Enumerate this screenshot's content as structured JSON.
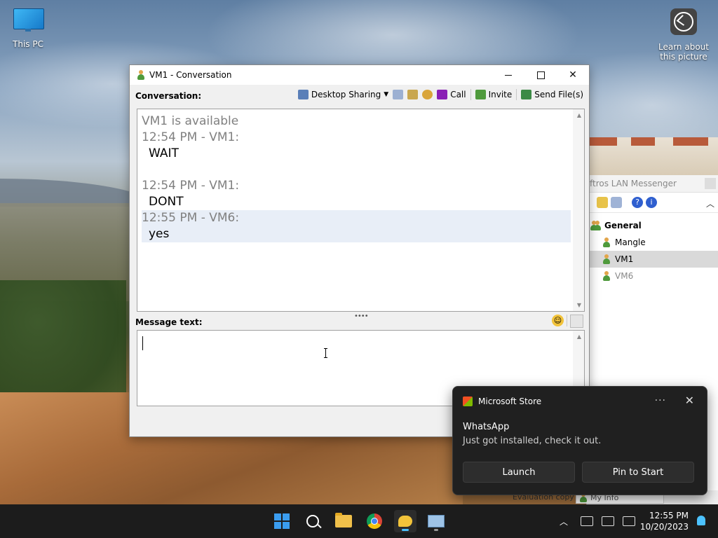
{
  "desktop": {
    "this_pc_label": "This PC",
    "learn_label_line1": "Learn about",
    "learn_label_line2": "this picture"
  },
  "buddy_list": {
    "title": "ftros LAN Messenger",
    "group_name": "General",
    "users": [
      {
        "name": "Mangle",
        "status": "online"
      },
      {
        "name": "VM1",
        "status": "online",
        "selected": true
      },
      {
        "name": "VM6",
        "status": "away"
      }
    ],
    "eval_text": "Evaluation copy",
    "my_info_label": "My Info"
  },
  "conversation": {
    "window_title": "VM1 - Conversation",
    "conversation_label": "Conversation:",
    "toolbar": {
      "desktop_sharing": "Desktop Sharing",
      "call": "Call",
      "invite": "Invite",
      "send_files": "Send File(s)"
    },
    "messages": [
      {
        "header": "VM1 is available",
        "text": ""
      },
      {
        "header": "12:54 PM - VM1:",
        "text": "WAIT"
      },
      {
        "header": "12:54 PM - VM1:",
        "text": "DONT"
      },
      {
        "header": "12:55 PM - VM6:",
        "text": "yes"
      }
    ],
    "message_text_label": "Message text:",
    "message_input_value": ""
  },
  "toast": {
    "source": "Microsoft Store",
    "app_name": "WhatsApp",
    "description": "Just got installed, check it out.",
    "launch_label": "Launch",
    "pin_label": "Pin to Start"
  },
  "taskbar": {
    "time": "12:55 PM",
    "date": "10/20/2023",
    "accent_color": "#4cc2ff"
  }
}
